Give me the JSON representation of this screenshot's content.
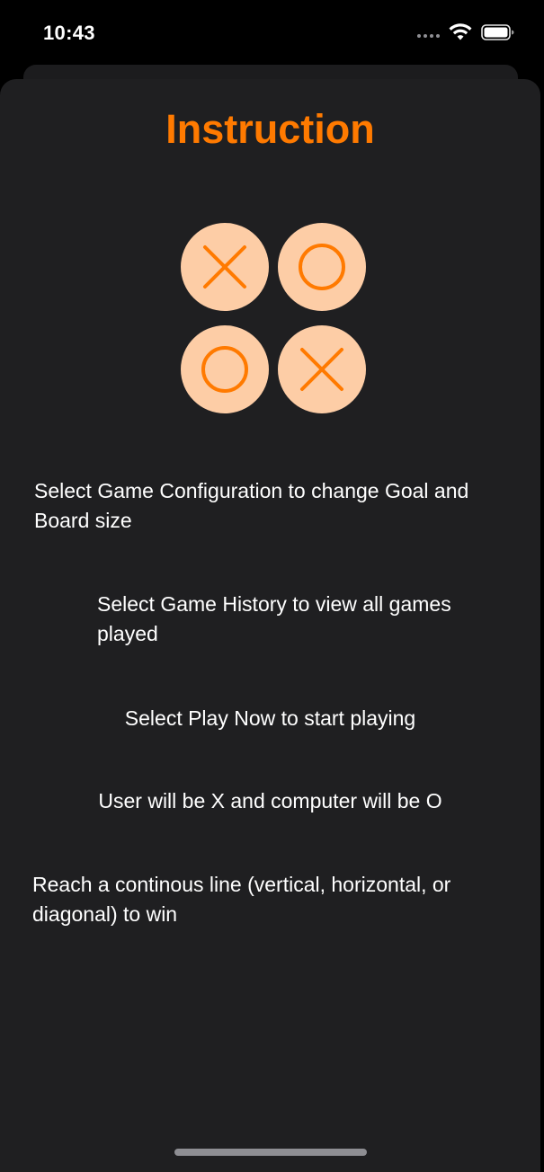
{
  "status_bar": {
    "time": "10:43"
  },
  "screen": {
    "title": "Instruction",
    "logo": {
      "cells": [
        "X",
        "O",
        "O",
        "X"
      ]
    },
    "instructions": [
      "Select Game Configuration to change Goal and Board size",
      "Select Game History to view all games played",
      "Select Play Now to start playing",
      "User will be X and computer will be O",
      "Reach a continous line (vertical, horizontal, or diagonal) to win"
    ]
  },
  "colors": {
    "accent": "#ff7a00",
    "logo_fill": "#fdcda6",
    "background": "#1f1f21",
    "text": "#ffffff"
  }
}
